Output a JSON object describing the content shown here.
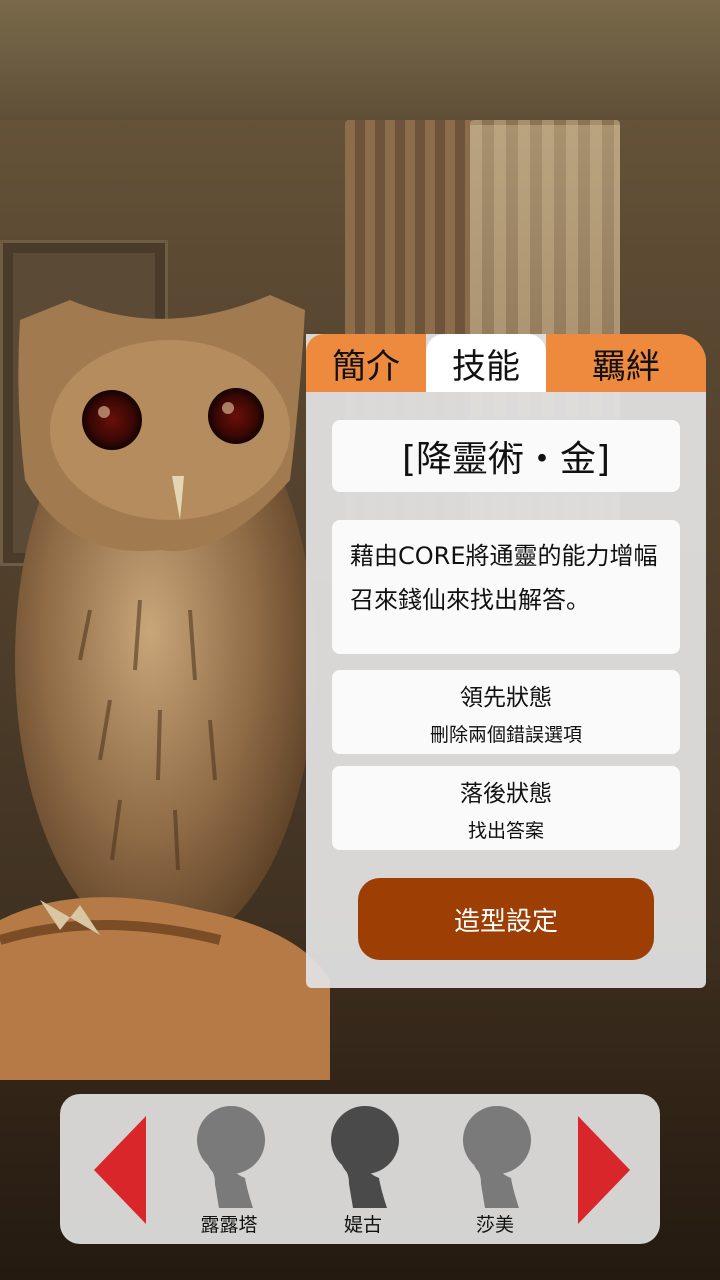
{
  "tabs": [
    {
      "label": "簡介",
      "active": false
    },
    {
      "label": "技能",
      "active": true
    },
    {
      "label": "羈絆",
      "active": false
    }
  ],
  "skill": {
    "name": "[降靈術・金]",
    "description_lines": [
      "藉由CORE將通靈的能力增幅",
      "召來錢仙來找出解答。"
    ],
    "states": [
      {
        "title": "領先狀態",
        "detail": "刪除兩個錯誤選項"
      },
      {
        "title": "落後狀態",
        "detail": "找出答案"
      }
    ]
  },
  "style_button": {
    "label": "造型設定"
  },
  "characters": [
    {
      "name": "露露塔",
      "icon": "silhouette-icon"
    },
    {
      "name": "媞古",
      "icon": "silhouette-icon"
    },
    {
      "name": "莎美",
      "icon": "silhouette-icon"
    }
  ],
  "colors": {
    "tab_orange": "#ee8a3e",
    "button_brown": "#9d3f05",
    "arrow_red": "#d9262a",
    "panel_gray": "#e1e1e1"
  }
}
